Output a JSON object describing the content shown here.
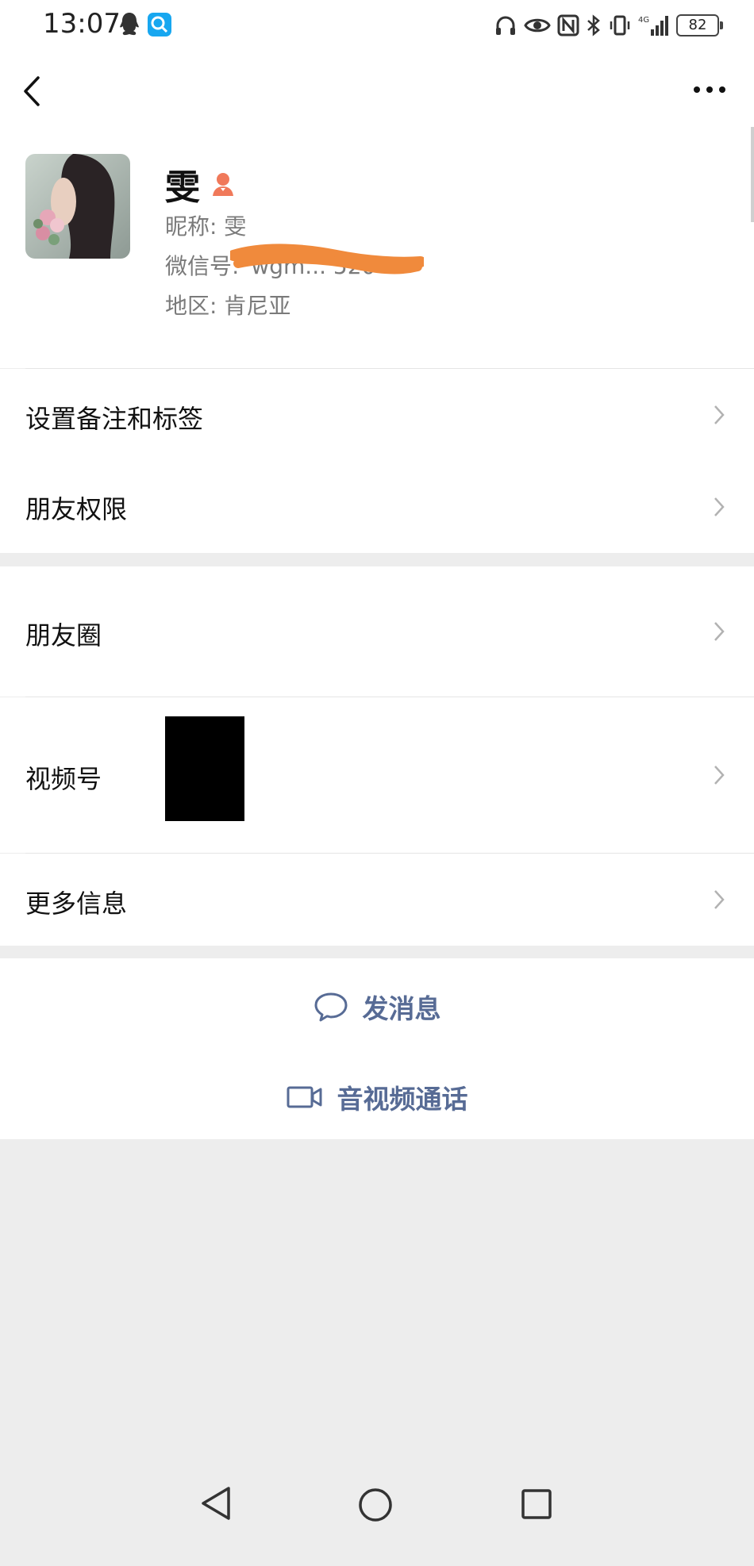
{
  "status_bar": {
    "time": "13:07",
    "battery": "82",
    "network": "4G"
  },
  "profile": {
    "name": "雯",
    "nickname_line": "昵称: 雯",
    "wechat_id_label": "微信号:",
    "wechat_id_partial": "wgm... 520",
    "region_line": "地区: 肯尼亚",
    "scribble_color": "#f08a3c"
  },
  "menu_top": [
    {
      "label": "设置备注和标签"
    },
    {
      "label": "朋友权限"
    }
  ],
  "menu_mid": [
    {
      "label": "朋友圈"
    },
    {
      "label": "视频号"
    },
    {
      "label": "更多信息"
    }
  ],
  "actions": {
    "send_message": "发消息",
    "video_call": "音视频通话",
    "accent_color": "#576b95"
  }
}
